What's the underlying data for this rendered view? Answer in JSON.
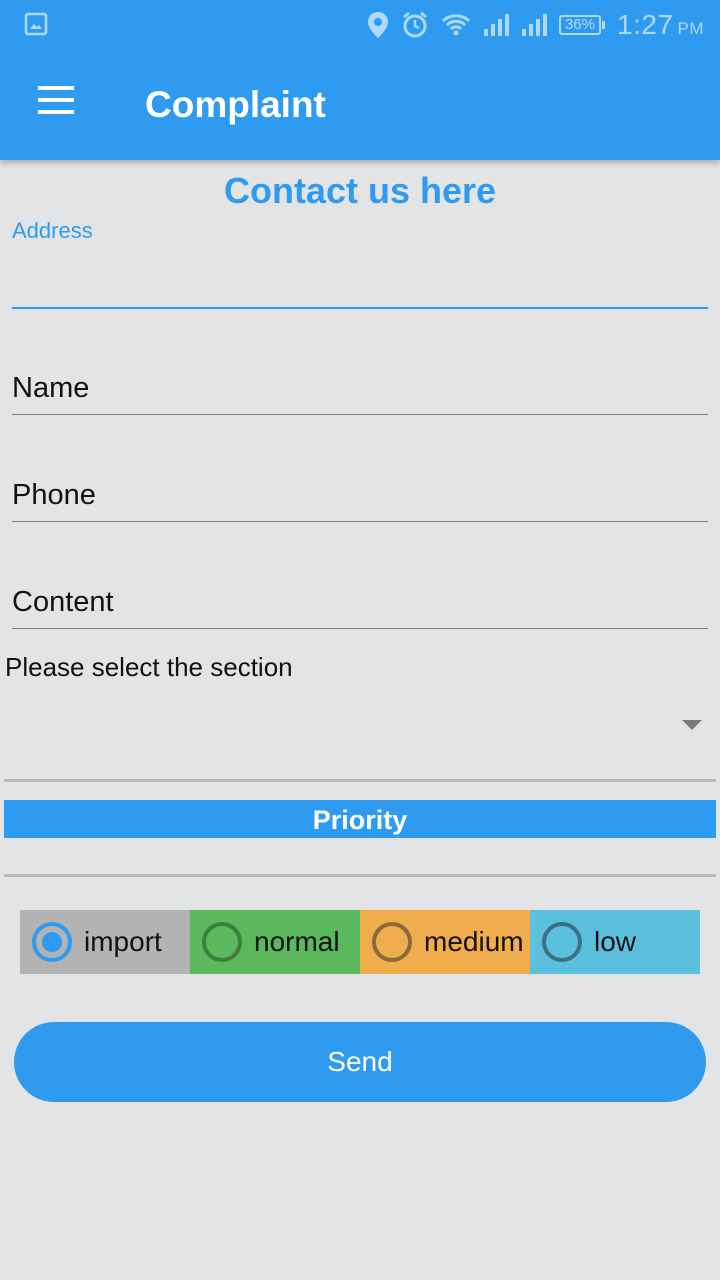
{
  "status_bar": {
    "battery": "36%",
    "time": "1:27",
    "ampm": "PM"
  },
  "app_bar": {
    "title": "Complaint"
  },
  "form": {
    "heading": "Contact us here",
    "address_label": "Address",
    "address_value": "",
    "name_hint": "Name",
    "phone_hint": "Phone",
    "content_hint": "Content",
    "section_label": "Please select the section",
    "section_selected": "",
    "priority_label": "Priority",
    "priority_options": [
      {
        "label": "import",
        "color": "#b3b3b3",
        "ring": "#2e9bf0",
        "checked": true
      },
      {
        "label": "normal",
        "color": "#5cb85c",
        "ring": "#3f7d3f",
        "checked": false
      },
      {
        "label": "medium",
        "color": "#f0ad4e",
        "ring": "#8a6a3a",
        "checked": false
      },
      {
        "label": "low",
        "color": "#5bc0de",
        "ring": "#3f6f7f",
        "checked": false
      }
    ],
    "send_label": "Send"
  },
  "colors": {
    "primary": "#2e9bf0",
    "background": "#e3e4e6"
  }
}
